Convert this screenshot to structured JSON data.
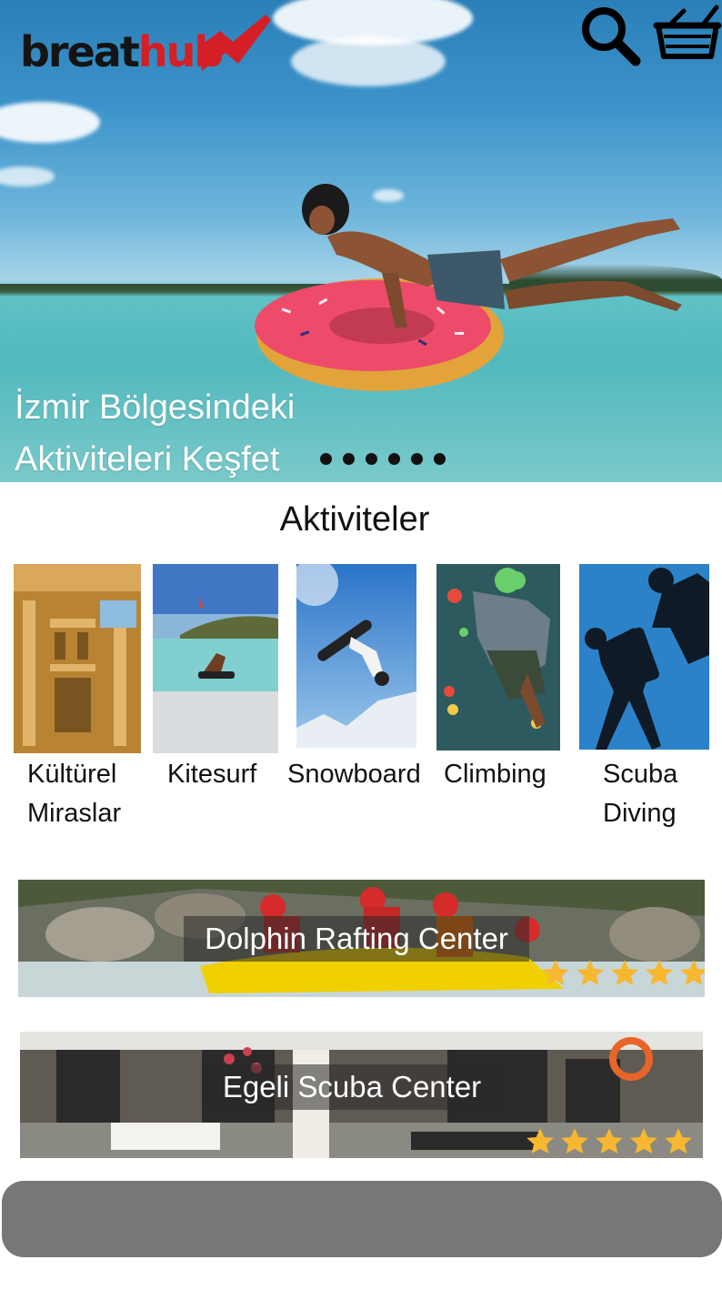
{
  "header": {
    "logo": {
      "part1": "breat",
      "part2": "hub"
    },
    "search_icon": "search-icon",
    "cart_icon": "basket-icon"
  },
  "hero": {
    "caption_line1": "İzmir Bölgesindeki",
    "caption_line2": "Aktiviteleri Keşfet",
    "slide_count": 6
  },
  "activities": {
    "title": "Aktiviteler",
    "items": [
      {
        "line1": "Kültürel",
        "line2": "Miraslar"
      },
      {
        "line1": "Kitesurf",
        "line2": ""
      },
      {
        "line1": "Snowboard",
        "line2": ""
      },
      {
        "line1": "Climbing",
        "line2": ""
      },
      {
        "line1": "Scuba",
        "line2": "Diving"
      }
    ]
  },
  "centers": [
    {
      "name": "Dolphin Rafting Center",
      "rating": 5
    },
    {
      "name": "Egeli Scuba Center",
      "rating": 5
    }
  ],
  "colors": {
    "brand_red": "#d51f26",
    "star": "#f7b731",
    "bottom_bar": "#777777"
  }
}
